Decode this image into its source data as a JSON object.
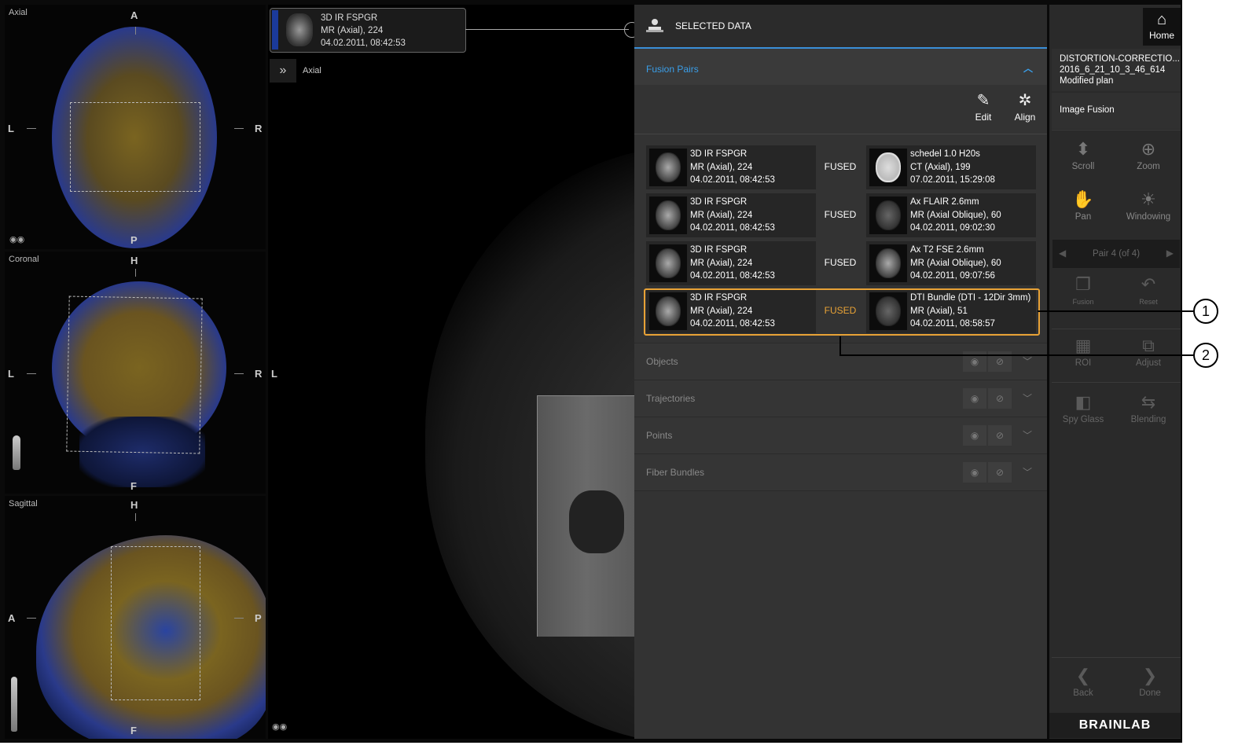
{
  "viewports": {
    "axial": {
      "title": "Axial",
      "top": "A",
      "bottom": "P",
      "left": "L",
      "right": "R"
    },
    "coronal": {
      "title": "Coronal",
      "top": "H",
      "bottom": "F",
      "left": "L",
      "right": "R"
    },
    "sagittal": {
      "title": "Sagittal",
      "top": "H",
      "bottom": "F",
      "left": "A",
      "right": "P"
    }
  },
  "main_view": {
    "info": {
      "line1": "3D IR FSPGR",
      "line2": "MR (Axial), 224",
      "line3": "04.02.2011, 08:42:53"
    },
    "view_toggle_icon": "double-chevron-right-icon",
    "view_name": "Axial",
    "left_marker": "L"
  },
  "panel": {
    "title": "SELECTED DATA",
    "fusion_section": "Fusion Pairs",
    "toolbar": {
      "edit_label": "Edit",
      "align_label": "Align"
    },
    "pairs": [
      {
        "left": {
          "line1": "3D IR FSPGR",
          "line2": "MR (Axial), 224",
          "line3": "04.02.2011, 08:42:53"
        },
        "status": "FUSED",
        "right": {
          "line1": "schedel 1.0 H20s",
          "line2": "CT (Axial), 199",
          "line3": "07.02.2011, 15:29:08"
        }
      },
      {
        "left": {
          "line1": "3D IR FSPGR",
          "line2": "MR (Axial), 224",
          "line3": "04.02.2011, 08:42:53"
        },
        "status": "FUSED",
        "right": {
          "line1": "Ax FLAIR 2.6mm",
          "line2": "MR (Axial Oblique), 60",
          "line3": "04.02.2011, 09:02:30"
        }
      },
      {
        "left": {
          "line1": "3D IR FSPGR",
          "line2": "MR (Axial), 224",
          "line3": "04.02.2011, 08:42:53"
        },
        "status": "FUSED",
        "right": {
          "line1": "Ax T2 FSE 2.6mm",
          "line2": "MR (Axial Oblique), 60",
          "line3": "04.02.2011, 09:07:56"
        }
      },
      {
        "left": {
          "line1": "3D IR FSPGR",
          "line2": "MR (Axial), 224",
          "line3": "04.02.2011, 08:42:53"
        },
        "status": "FUSED",
        "right": {
          "line1": "DTI Bundle (DTI - 12Dir 3mm)",
          "line2": "MR (Axial), 51",
          "line3": "04.02.2011, 08:58:57"
        }
      }
    ],
    "selected_pair_index": 4,
    "selected_status_color": "#e8a236",
    "sections": [
      "Objects",
      "Trajectories",
      "Points",
      "Fiber Bundles"
    ]
  },
  "sidebar": {
    "home_label": "Home",
    "plan": {
      "line1": "DISTORTION-CORRECTIO...",
      "line2": "2016_6_21_10_3_46_614",
      "line3": "Modified plan"
    },
    "step": "Image Fusion",
    "tools": {
      "scroll": "Scroll",
      "zoom": "Zoom",
      "pan": "Pan",
      "windowing": "Windowing"
    },
    "pair_nav": "Pair 4 (of 4)",
    "tools2": {
      "fusion": "Fusion",
      "reset": "Reset",
      "roi": "ROI",
      "adjust": "Adjust",
      "spyglass": "Spy Glass",
      "blending": "Blending"
    },
    "back": "Back",
    "done": "Done",
    "brand": "BRAINLAB"
  },
  "callouts": {
    "one": "1",
    "two": "2"
  },
  "colors": {
    "accent_blue": "#3a9ee8",
    "selection_orange": "#e8a236",
    "overlay_yellow": "#b8922a",
    "overlay_blue": "#2a4aa0"
  }
}
